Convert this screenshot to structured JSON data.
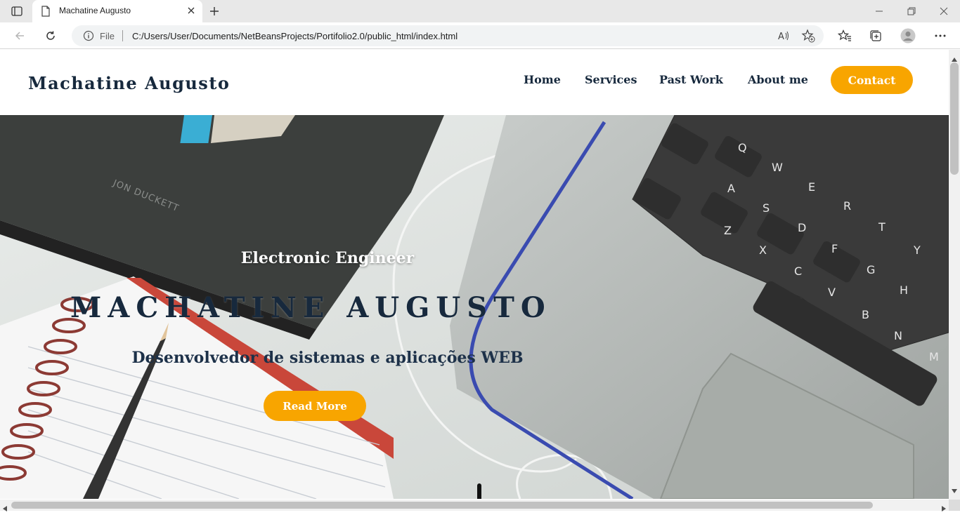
{
  "browser": {
    "tab": {
      "title": "Machatine Augusto"
    },
    "address": {
      "scheme_label": "File",
      "url": "C:/Users/User/Documents/NetBeansProjects/Portifolio2.0/public_html/index.html"
    }
  },
  "site": {
    "brand": "Machatine Augusto",
    "nav": [
      {
        "label": "Home"
      },
      {
        "label": "Services"
      },
      {
        "label": "Past Work"
      },
      {
        "label": "About me"
      }
    ],
    "contact_label": "Contact",
    "hero": {
      "kicker": "Electronic Engineer",
      "title": "MACHATINE AUGUSTO",
      "subtitle": "Desenvolvedor de sistemas e aplicações WEB",
      "cta_label": "Read More",
      "background_text": "JON DUCKETT"
    }
  },
  "colors": {
    "accent": "#f8a500",
    "navy": "#17293d"
  }
}
